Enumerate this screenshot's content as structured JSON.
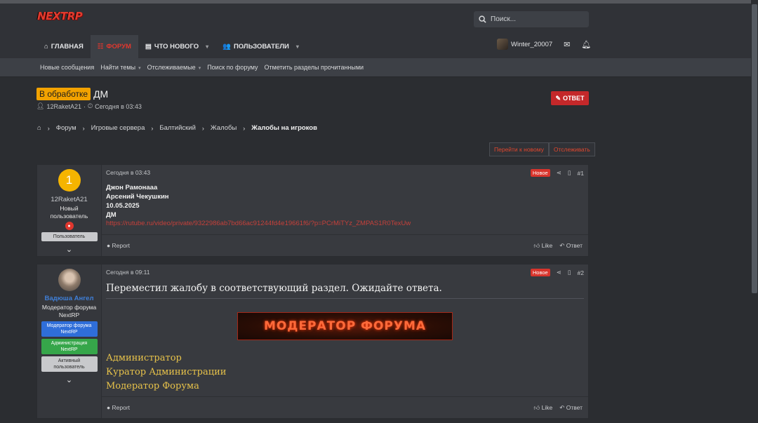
{
  "brand": {
    "logo_text": "NEXTRP"
  },
  "search": {
    "placeholder": "Поиск..."
  },
  "nav": {
    "tabs": [
      {
        "label": "ГЛАВНАЯ",
        "icon": "home-icon"
      },
      {
        "label": "ФОРУМ",
        "icon": "forum-icon",
        "active": true
      },
      {
        "label": "ЧТО НОВОГО",
        "icon": "whats-new-icon"
      },
      {
        "label": "ПОЛЬЗОВАТЕЛИ",
        "icon": "users-icon"
      }
    ],
    "username": "Winter_20007"
  },
  "subnav": {
    "items": [
      "Новые сообщения",
      "Найти темы",
      "Отслеживаемые",
      "Поиск по форуму",
      "Отметить разделы прочитанными"
    ]
  },
  "thread": {
    "prefix": "В обработке",
    "title": "ДМ",
    "author": "12RaketA21",
    "date": "Сегодня в 03:43",
    "reply_label": "ОТВЕТ",
    "goto_new": "Перейти к новому",
    "watch": "Отслеживать"
  },
  "breadcrumb": [
    "Форум",
    "Игровые сервера",
    "Балтийский",
    "Жалобы",
    "Жалобы на игроков"
  ],
  "posts": [
    {
      "avatar_letter": "1",
      "username": "12RaketA21",
      "user_title": "Новый пользователь",
      "banner": "Пользователь",
      "date": "Сегодня в 03:43",
      "badge": "Новое",
      "number": "#1",
      "lines": [
        "Джон Рамонааа",
        "Арсений Чекушкин",
        "10.05.2025",
        "ДМ"
      ],
      "link": "https://rutube.ru/video/private/9322986ab7bd66ac91244fd4e19661f6/?p=PCrMiTYz_ZMPAS1R0TexUw",
      "report": "Report",
      "like": "Like",
      "reply": "Ответ"
    },
    {
      "username": "Вадюша Ангел",
      "user_title": "Модератор форума NextRP",
      "banners": [
        "Модератор форума NextRP",
        "Администрация NextRP",
        "Активный пользователь"
      ],
      "date": "Сегодня в 09:11",
      "badge": "Новое",
      "number": "#2",
      "message": "Переместил жалобу в соответствующий раздел. Ожидайте ответа.",
      "signature_banner": "МОДЕРАТОР ФОРУМА",
      "signature_lines": [
        "Администратор",
        "Куратор Администрации",
        "Модератор Форума"
      ],
      "report": "Report",
      "like": "Like",
      "reply": "Ответ"
    }
  ]
}
